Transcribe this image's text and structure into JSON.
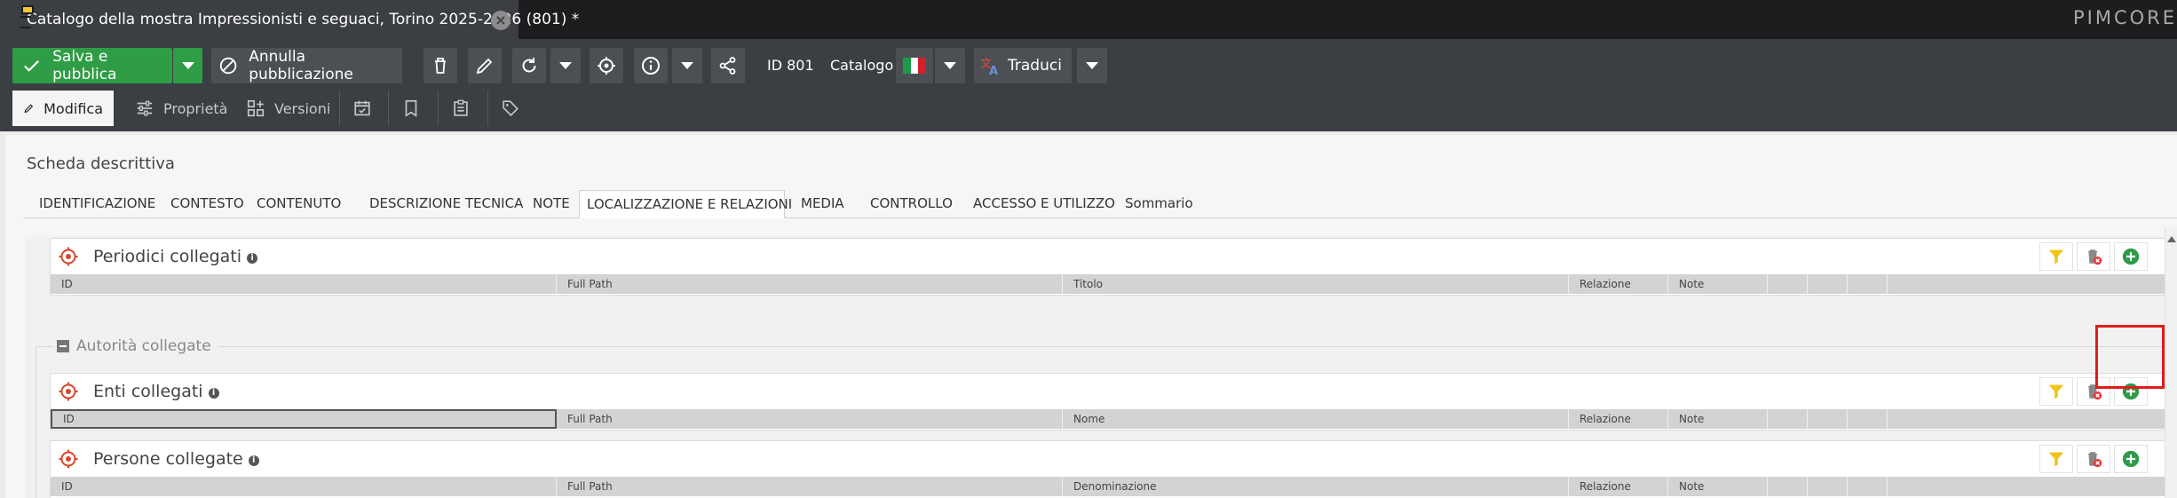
{
  "tabbar": {
    "doc_title": "Catalogo della mostra Impressionisti e seguaci, Torino 2025-2026 (801) *",
    "brand": "PIMCORE"
  },
  "toolbar": {
    "save_label": "Salva e pubblica",
    "unpublish_label": "Annulla pubblicazione",
    "id_label": "ID 801",
    "class_label": "Catalogo",
    "translate_label": "Traduci"
  },
  "subtabs": {
    "edit": "Modifica",
    "properties": "Proprietà",
    "versions": "Versioni"
  },
  "panel": {
    "title": "Scheda descrittiva"
  },
  "section_tabs": [
    "IDENTIFICAZIONE",
    "CONTESTO",
    "CONTENUTO",
    "DESCRIZIONE TECNICA",
    "NOTE",
    "LOCALIZZAZIONE E RELAZIONI",
    "MEDIA",
    "CONTROLLO",
    "ACCESSO E UTILIZZO",
    "Sommario"
  ],
  "active_section_tab": "LOCALIZZAZIONE E RELAZIONI",
  "fieldset": {
    "legend": "Autorità collegate"
  },
  "relations": [
    {
      "title": "Periodici collegati",
      "columns": [
        "ID",
        "Full Path",
        "Titolo",
        "Relazione",
        "Note"
      ]
    },
    {
      "title": "Enti collegati",
      "columns": [
        "ID",
        "Full Path",
        "Nome",
        "Relazione",
        "Note"
      ]
    },
    {
      "title": "Persone collegate",
      "columns": [
        "ID",
        "Full Path",
        "Denominazione",
        "Relazione",
        "Note"
      ]
    }
  ],
  "colors": {
    "save_green": "#2f9d46",
    "toolbar_bg": "#3b3e42",
    "highlight_red": "#e21b1b",
    "target_icon": "#d9472b",
    "filter_yellow": "#f0c419",
    "add_green": "#2e9b47"
  }
}
